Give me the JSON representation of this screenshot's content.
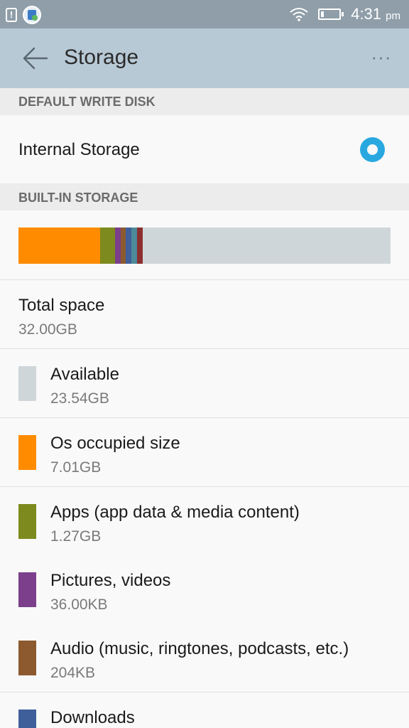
{
  "status_bar": {
    "time": "4:31",
    "ampm": "pm",
    "icons": [
      "notification-alert-icon",
      "app-notification-icon",
      "wifi-icon",
      "battery-icon"
    ]
  },
  "app_bar": {
    "title": "Storage",
    "back_icon": "back-arrow-icon",
    "overflow_label": "···"
  },
  "default_write_disk": {
    "header": "DEFAULT WRITE DISK",
    "option_label": "Internal Storage",
    "selected": true,
    "accent_color": "#29a8e0"
  },
  "built_in_storage": {
    "header": "BUILT-IN STORAGE",
    "bar_segments": [
      {
        "name": "os",
        "color": "#ff8c00",
        "fraction": 0.219
      },
      {
        "name": "apps",
        "color": "#7d8a1e",
        "fraction": 0.04
      },
      {
        "name": "pictures",
        "color": "#7b3f8c",
        "fraction": 0.015
      },
      {
        "name": "audio",
        "color": "#8c5a2e",
        "fraction": 0.015
      },
      {
        "name": "downloads",
        "color": "#3f5f9a",
        "fraction": 0.015
      },
      {
        "name": "misc",
        "color": "#4d8a9a",
        "fraction": 0.015
      },
      {
        "name": "cache",
        "color": "#8c2f2f",
        "fraction": 0.015
      }
    ],
    "available_color": "#cfd6da"
  },
  "rows": {
    "total": {
      "label": "Total space",
      "value": "32.00GB"
    },
    "available": {
      "label": "Available",
      "value": "23.54GB",
      "color": "#cfd6da"
    },
    "os": {
      "label": "Os occupied size",
      "value": "7.01GB",
      "color": "#ff8c00"
    },
    "apps": {
      "label": "Apps (app data & media content)",
      "value": "1.27GB",
      "color": "#7d8a1e"
    },
    "pictures": {
      "label": "Pictures, videos",
      "value": "36.00KB",
      "color": "#7b3f8c"
    },
    "audio": {
      "label": "Audio (music, ringtones, podcasts, etc.)",
      "value": "204KB",
      "color": "#8c5a2e"
    },
    "downloads": {
      "label": "Downloads",
      "color": "#3f5f9a"
    }
  }
}
